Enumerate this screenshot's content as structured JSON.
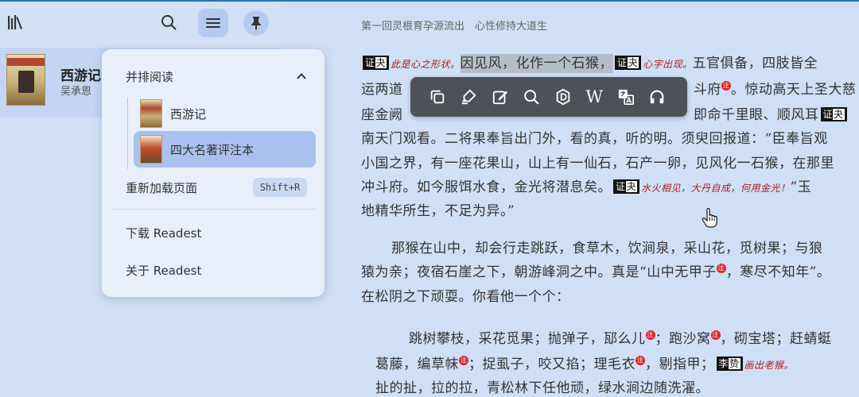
{
  "sidebar": {
    "book": {
      "title": "西游记",
      "author": "吴承恩"
    },
    "icons": {
      "library": "library-icon",
      "search": "search-icon",
      "menu": "menu-icon",
      "pin": "pin-icon"
    }
  },
  "menu": {
    "parallel_read": "并排阅读",
    "books": [
      {
        "title": "西游记",
        "active": false
      },
      {
        "title": "四大名著评注本",
        "active": true
      }
    ],
    "reload": "重新加载页面",
    "reload_shortcut": "Shift+R",
    "download": "下载 Readest",
    "about": "关于 Readest"
  },
  "reader": {
    "chapter_title": "第一回灵根育孕源流出　心性修持大道生",
    "tag_label": "证",
    "tag_label2": "夬",
    "comments": {
      "c1": "此是心之形状。",
      "c2": "心字出现。",
      "c3": "水火相见，大丹自成，何用金光！",
      "c4": "画出老猴。"
    },
    "lines": {
      "l1_sel": "因见风，化作一个石猴，",
      "l1_tail": "五官俱备，四肢皆全",
      "l2_head": "运两道",
      "l2_tail": "斗府",
      "l2_tail2": "。惊动高天上圣大慈",
      "l3_head": "座金阙",
      "l3_tail": "即命千里眼、顺风耳",
      "l4": "南天门观看。二将果奉旨出门外，看的真，听的明。须臾回报道：“臣奉旨观",
      "l5": "小国之界，有一座花果山，山上有一仙石，石产一卵，见风化一石猴，在那里",
      "l6_head": "冲斗府。如今服饵水食，金光将潜息矣。",
      "l6_tail": "”玉",
      "l7": "地精华所生，不足为异。”",
      "l8": "那猴在山中，却会行走跳跃，食草木，饮涧泉，采山花，觅树果；与狼",
      "l9_head": "猿为亲；夜宿石崖之下，朝游峰洞之中。真是“山中无甲子",
      "l9_tail": "，寒尽不知年”。",
      "l10": "在松阴之下顽耍。你看他一个个：",
      "l11_a": "跳树攀枝，采花觅果；抛弹子，邷么儿",
      "l11_b": "；跑沙窝",
      "l11_c": "，砌宝塔；赶蜻蜓",
      "l12_a": "葛藤，编草帓",
      "l12_b": "；捉虱子，咬又掐；理毛衣",
      "l12_c": "，剔指甲；",
      "l13": "扯的扯，拉的拉，青松林下任他顽，绿水涧边随洗濯。"
    },
    "tag_li": "李",
    "tag_li2": "贽",
    "note_glyph": "注"
  },
  "toolbar": {
    "icons": [
      "copy-icon",
      "highlight-icon",
      "annotate-icon",
      "search-icon",
      "dictionary-icon",
      "wikipedia-icon",
      "translate-icon",
      "speak-icon"
    ],
    "wiki_glyph": "W"
  },
  "colors": {
    "sidebar": "#d2e0f6",
    "reader": "#cfdff6",
    "menu": "#e8effb",
    "active": "#a9c1ec",
    "toolbar": "#4e5157",
    "accent_line": "#2a74a8"
  }
}
